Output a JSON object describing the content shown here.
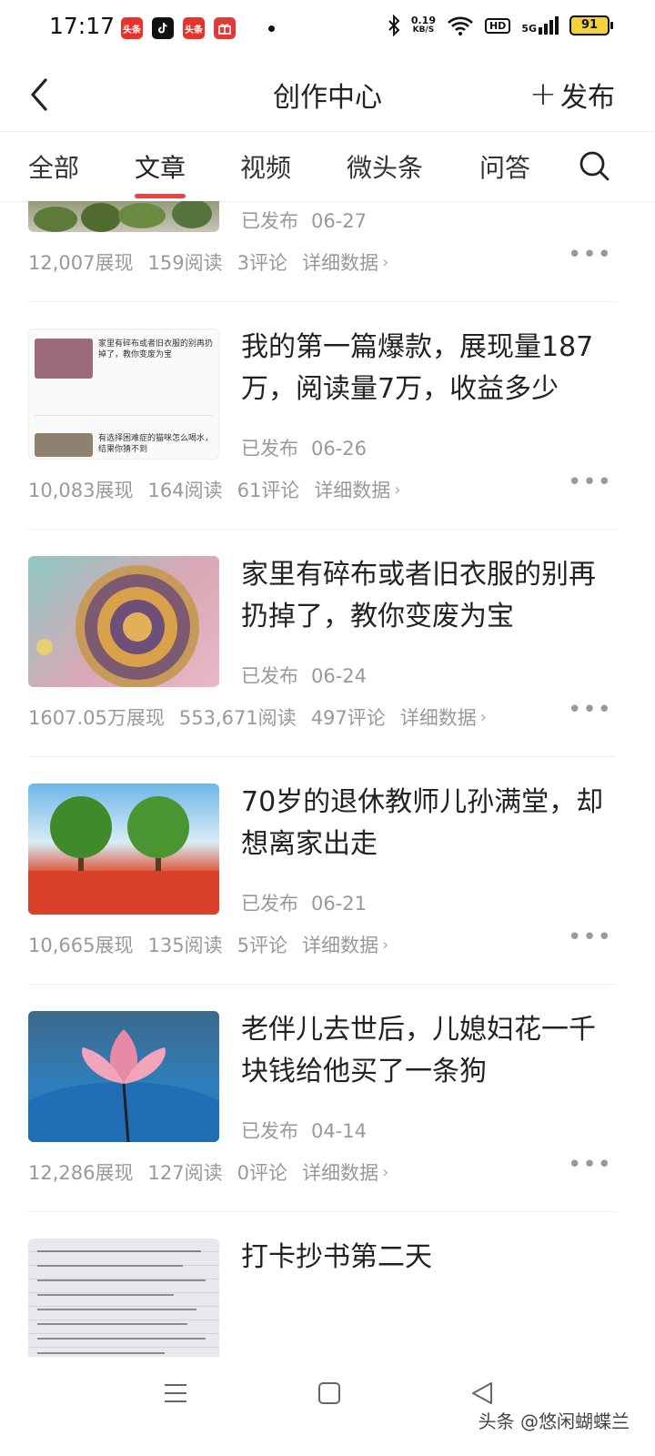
{
  "status_bar": {
    "time": "17:17",
    "apps": [
      {
        "name": "toutiao-app-icon",
        "label": "头条",
        "color": "#e8322c"
      },
      {
        "name": "tiktok-app-icon",
        "label": "",
        "color": "#111111"
      },
      {
        "name": "toutiao-lite-app-icon",
        "label": "头条",
        "color": "#e8322c"
      },
      {
        "name": "gift-app-icon",
        "label": "",
        "color": "#e23a3a"
      }
    ],
    "net_speed": "0.19",
    "net_unit": "KB/S",
    "hd": "HD",
    "signal": "5G",
    "battery": "91"
  },
  "header": {
    "title": "创作中心",
    "publish_label": "发布"
  },
  "tabs": [
    {
      "label": "全部",
      "active": false
    },
    {
      "label": "文章",
      "active": true
    },
    {
      "label": "视频",
      "active": false
    },
    {
      "label": "微头条",
      "active": false
    },
    {
      "label": "问答",
      "active": false
    }
  ],
  "articles": [
    {
      "title": "",
      "status": "已发布",
      "date": "06-27",
      "impressions": "12,007展现",
      "reads": "159阅读",
      "comments": "3评论",
      "detail": "详细数据"
    },
    {
      "title": "我的第一篇爆款，展现量187万，阅读量7万，收益多少",
      "status": "已发布",
      "date": "06-26",
      "impressions": "10,083展现",
      "reads": "164阅读",
      "comments": "61评论",
      "detail": "详细数据",
      "thumb_text": [
        "家里有碎布或者旧衣服的别再扔掉了，教你变废为宝",
        "有选择困难症的猫咪怎么喝水，结果你猜不到"
      ]
    },
    {
      "title": "家里有碎布或者旧衣服的别再扔掉了，教你变废为宝",
      "status": "已发布",
      "date": "06-24",
      "impressions": "1607.05万展现",
      "reads": "553,671阅读",
      "comments": "497评论",
      "detail": "详细数据"
    },
    {
      "title": "70岁的退休教师儿孙满堂，却想离家出走",
      "status": "已发布",
      "date": "06-21",
      "impressions": "10,665展现",
      "reads": "135阅读",
      "comments": "5评论",
      "detail": "详细数据"
    },
    {
      "title": "老伴儿去世后，儿媳妇花一千块钱给他买了一条狗",
      "status": "已发布",
      "date": "04-14",
      "impressions": "12,286展现",
      "reads": "127阅读",
      "comments": "0评论",
      "detail": "详细数据"
    },
    {
      "title": "打卡抄书第二天"
    }
  ],
  "watermark": "头条 @悠闲蝴蝶兰",
  "accent_color": "#f04142"
}
